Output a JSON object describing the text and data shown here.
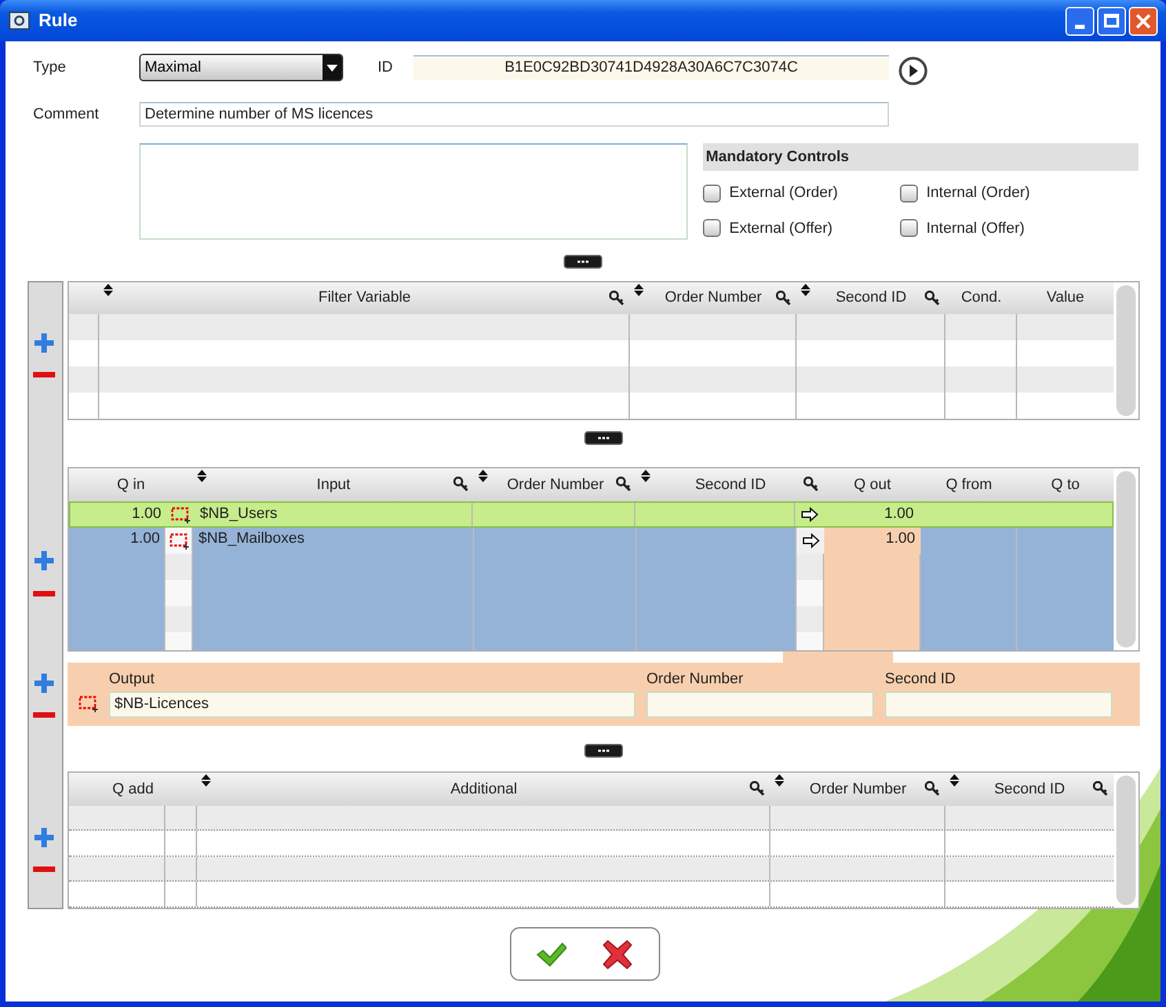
{
  "window": {
    "title": "Rule"
  },
  "form": {
    "type_label": "Type",
    "type_value": "Maximal",
    "id_label": "ID",
    "id_value": "B1E0C92BD30741D4928A30A6C7C3074C",
    "comment_label": "Comment",
    "comment_value": "Determine number of MS licences"
  },
  "mandatory_controls": {
    "title": "Mandatory Controls",
    "items": [
      {
        "label": "External (Order)",
        "checked": false
      },
      {
        "label": "Internal (Order)",
        "checked": false
      },
      {
        "label": "External (Offer)",
        "checked": false
      },
      {
        "label": "Internal (Offer)",
        "checked": false
      }
    ]
  },
  "filter_table": {
    "columns": [
      {
        "label": "Filter Variable",
        "sortable": true
      },
      {
        "label": "Order Number",
        "sortable": true
      },
      {
        "label": "Second ID",
        "sortable": true
      },
      {
        "label": "Cond.",
        "sortable": false
      },
      {
        "label": "Value",
        "sortable": false
      }
    ]
  },
  "input_table": {
    "columns": [
      {
        "label": "Q in",
        "sortable": false
      },
      {
        "label": "Input",
        "sortable": true
      },
      {
        "label": "Order Number",
        "sortable": true
      },
      {
        "label": "Second ID",
        "sortable": true
      },
      {
        "label": "Q out",
        "sortable": false
      },
      {
        "label": "Q from",
        "sortable": false
      },
      {
        "label": "Q to",
        "sortable": false
      }
    ],
    "rows": [
      {
        "q_in": "1.00",
        "input": "$NB_Users",
        "q_out": "1.00",
        "selected": true
      },
      {
        "q_in": "1.00",
        "input": "$NB_Mailboxes",
        "q_out": "1.00",
        "selected": false
      }
    ]
  },
  "output_panel": {
    "output_label": "Output",
    "output_value": "$NB-Licences",
    "order_number_label": "Order Number",
    "second_id_label": "Second ID"
  },
  "additional_table": {
    "columns": [
      {
        "label": "Q add",
        "sortable": false
      },
      {
        "label": "Additional",
        "sortable": true
      },
      {
        "label": "Order Number",
        "sortable": true
      },
      {
        "label": "Second ID",
        "sortable": true
      }
    ]
  }
}
